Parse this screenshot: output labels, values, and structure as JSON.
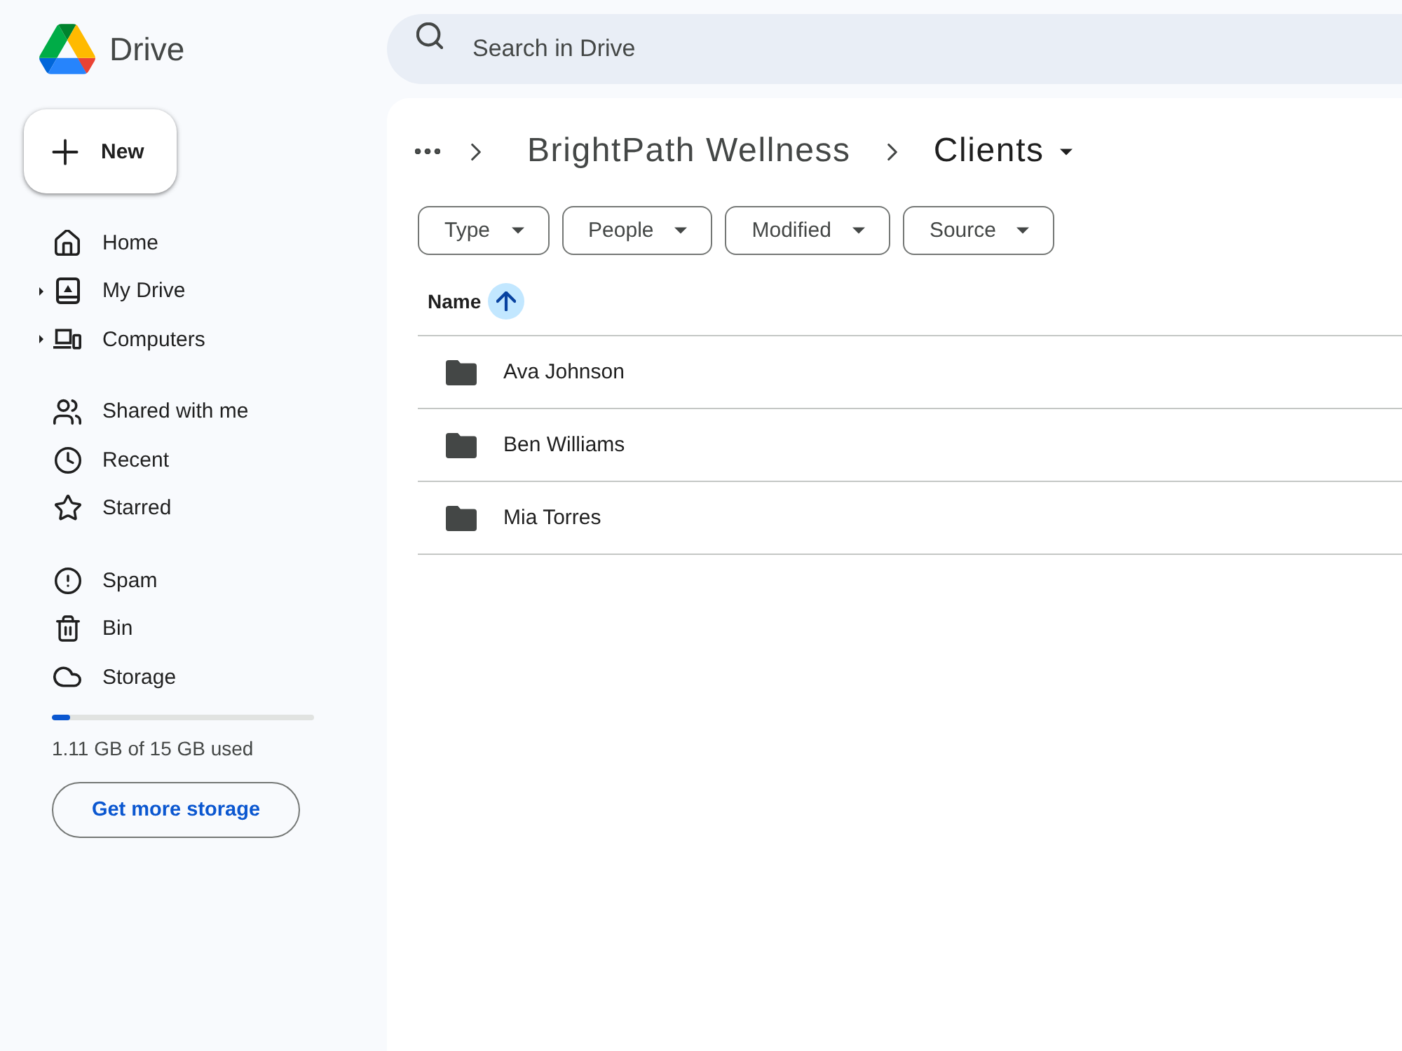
{
  "app": {
    "name": "Drive"
  },
  "search": {
    "placeholder": "Search in Drive"
  },
  "sidebar": {
    "new_button": "New",
    "sections": [
      {
        "items": [
          {
            "kind": "home",
            "label": "Home",
            "expandable": false,
            "selected": false
          },
          {
            "kind": "my_drive",
            "label": "My Drive",
            "expandable": true,
            "selected": false
          },
          {
            "kind": "computers",
            "label": "Computers",
            "expandable": true,
            "selected": false
          }
        ]
      },
      {
        "items": [
          {
            "kind": "shared",
            "label": "Shared with me",
            "expandable": false,
            "selected": false
          },
          {
            "kind": "recent",
            "label": "Recent",
            "expandable": false,
            "selected": false
          },
          {
            "kind": "starred",
            "label": "Starred",
            "expandable": false,
            "selected": false
          }
        ]
      },
      {
        "items": [
          {
            "kind": "spam",
            "label": "Spam",
            "expandable": false,
            "selected": false
          },
          {
            "kind": "bin",
            "label": "Bin",
            "expandable": false,
            "selected": false
          },
          {
            "kind": "storage",
            "label": "Storage",
            "expandable": false,
            "selected": false
          }
        ]
      }
    ],
    "storage": {
      "level": 0.07,
      "usage": "1.11 GB of 15 GB used",
      "button": "Get more storage"
    }
  },
  "breadcrumb": {
    "items": [
      {
        "label": "BrightPath Wellness",
        "current": false
      },
      {
        "label": "Clients",
        "current": true
      }
    ]
  },
  "filters": [
    "Type",
    "People",
    "Modified",
    "Source"
  ],
  "table": {
    "columns": [
      {
        "label": "Name",
        "sorted": true,
        "ascending": true
      }
    ],
    "rows": [
      {
        "name": "Ava Johnson"
      },
      {
        "name": "Ben Williams"
      },
      {
        "name": "Mia Torres"
      }
    ]
  }
}
